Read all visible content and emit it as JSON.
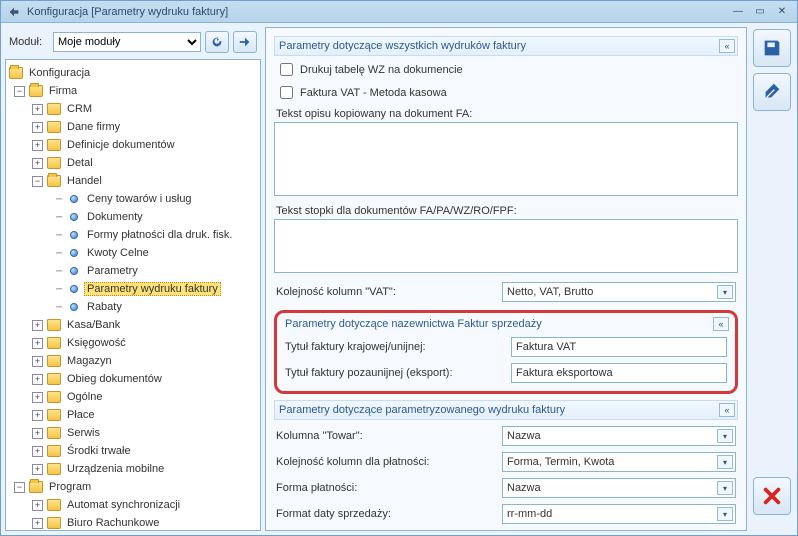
{
  "window": {
    "title": "Konfiguracja [Parametry wydruku faktury]"
  },
  "module": {
    "label": "Moduł:",
    "selected": "Moje moduły"
  },
  "tree": {
    "root": "Konfiguracja",
    "firma": "Firma",
    "firma_children": {
      "crm": "CRM",
      "dane_firmy": "Dane firmy",
      "definicje_dok": "Definicje dokumentów",
      "detal": "Detal",
      "handel": "Handel",
      "kasa_bank": "Kasa/Bank",
      "ksiegowosc": "Księgowość",
      "magazyn": "Magazyn",
      "obieg_dok": "Obieg dokumentów",
      "ogolne": "Ogólne",
      "place": "Płace",
      "serwis": "Serwis",
      "srodki_trwale": "Środki trwałe",
      "urzadzenia_mobilne": "Urządzenia mobilne"
    },
    "handel_children": {
      "ceny": "Ceny towarów i usług",
      "dokumenty": "Dokumenty",
      "formy_platnosci": "Formy płatności dla druk. fisk.",
      "kwoty_celne": "Kwoty Celne",
      "parametry": "Parametry",
      "parametry_wydruku": "Parametry wydruku faktury",
      "rabaty": "Rabaty"
    },
    "program": "Program",
    "program_children": {
      "automat": "Automat synchronizacji",
      "biuro": "Biuro Rachunkowe"
    }
  },
  "sections": {
    "wszystkie": "Parametry dotyczące wszystkich wydruków faktury",
    "nazewnictwo": "Parametry dotyczące nazewnictwa Faktur sprzedaży",
    "parametryzowany": "Parametry dotyczące parametryzowanego wydruku faktury"
  },
  "fields": {
    "drukuj_wz": "Drukuj tabelę WZ na dokumencie",
    "metoda_kasowa": "Faktura VAT - Metoda kasowa",
    "tekst_opisu_label": "Tekst opisu kopiowany na dokument FA:",
    "tekst_opisu_value": "",
    "tekst_stopki_label": "Tekst stopki dla dokumentów FA/PA/WZ/RO/FPF:",
    "tekst_stopki_value": "",
    "kolejnosc_vat_label": "Kolejność kolumn \"VAT\":",
    "kolejnosc_vat_value": "Netto, VAT, Brutto",
    "tytul_krajowy_label": "Tytuł faktury krajowej/unijnej:",
    "tytul_krajowy_value": "Faktura VAT",
    "tytul_eksport_label": "Tytuł faktury pozaunijnej (eksport):",
    "tytul_eksport_value": "Faktura eksportowa",
    "kolumna_towar_label": "Kolumna \"Towar\":",
    "kolumna_towar_value": "Nazwa",
    "kolejnosc_platnosci_label": "Kolejność kolumn dla płatności:",
    "kolejnosc_platnosci_value": "Forma, Termin, Kwota",
    "forma_platnosci_label": "Forma płatności:",
    "forma_platnosci_value": "Nazwa",
    "format_daty_label": "Format daty sprzedaży:",
    "format_daty_value": "rr-mm-dd"
  }
}
